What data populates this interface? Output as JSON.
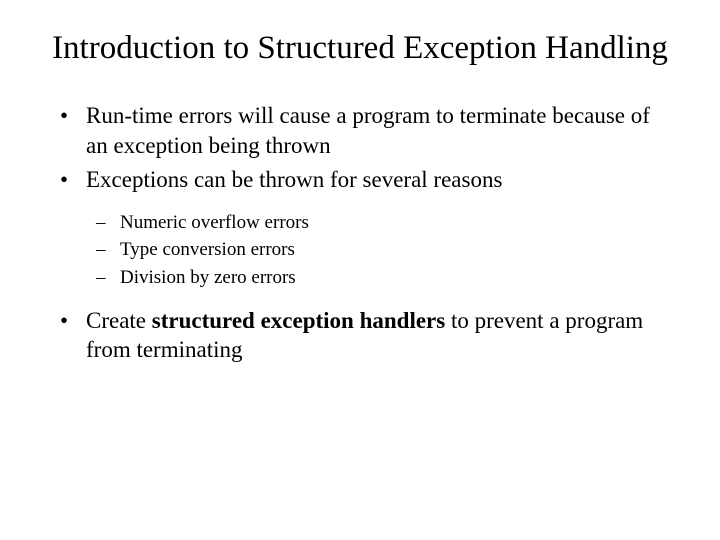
{
  "title": "Introduction to Structured Exception Handling",
  "bullets": {
    "b1": "Run-time errors will cause a program to terminate because of an exception being thrown",
    "b2": "Exceptions can be thrown for several reasons",
    "b3_pre": "Create ",
    "b3_bold": "structured exception handlers",
    "b3_post": " to prevent a program from terminating"
  },
  "sub": {
    "s1": "Numeric overflow errors",
    "s2": "Type conversion errors",
    "s3": "Division by zero errors"
  }
}
